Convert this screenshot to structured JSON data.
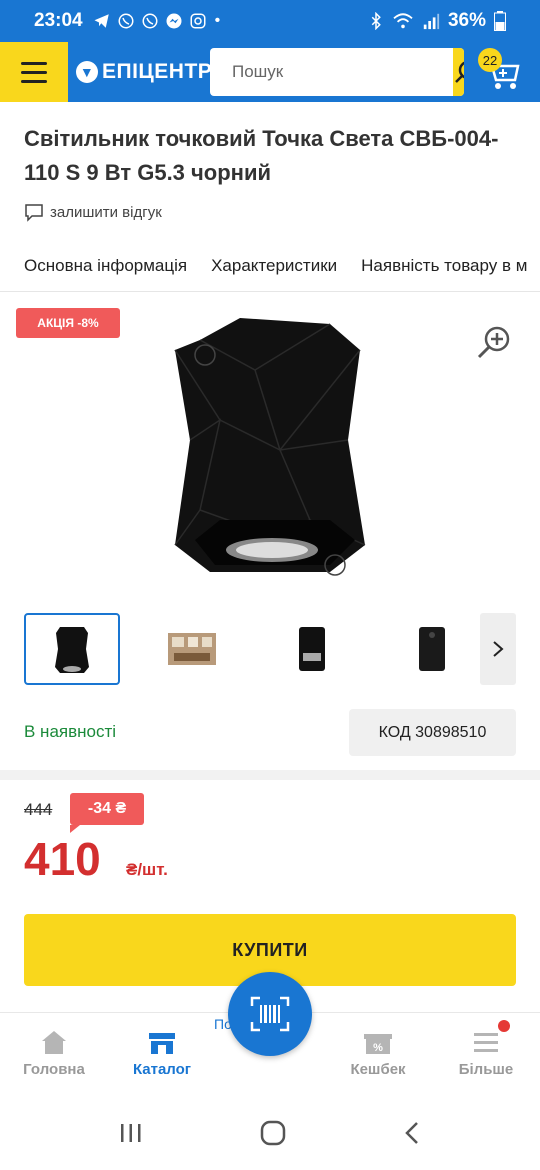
{
  "status_bar": {
    "time": "23:04",
    "battery": "36%",
    "dot": "•"
  },
  "header": {
    "logo_text": "ЕПІЦЕНТР",
    "search_placeholder": "Пошук",
    "cart_count": "22"
  },
  "product": {
    "title": "Світильник точковий Точка Света СВБ-004-110 S 9 Вт G5.3 чорний",
    "review_link": "залишити відгук",
    "promo_badge": "АКЦІЯ -8%",
    "availability": "В наявності",
    "code": "КОД 30898510",
    "old_price": "444",
    "discount": "-34 ₴",
    "price": "410",
    "unit": "₴/шт.",
    "buy_label": "КУПИТИ"
  },
  "tabs": [
    {
      "label": "Основна інформація"
    },
    {
      "label": "Характеристики"
    },
    {
      "label": "Наявність товару в м"
    }
  ],
  "bottom_nav": {
    "items": [
      {
        "label": "Головна"
      },
      {
        "label": "Каталог"
      },
      {
        "label": "Кешбек"
      },
      {
        "label": "Більше"
      }
    ],
    "compare_peek": "Порівн"
  },
  "colors": {
    "brand_blue": "#1976d2",
    "brand_yellow": "#f9d71c",
    "sale_red": "#f05a5a",
    "price_red": "#d32f2f",
    "stock_green": "#1b8a3a"
  }
}
